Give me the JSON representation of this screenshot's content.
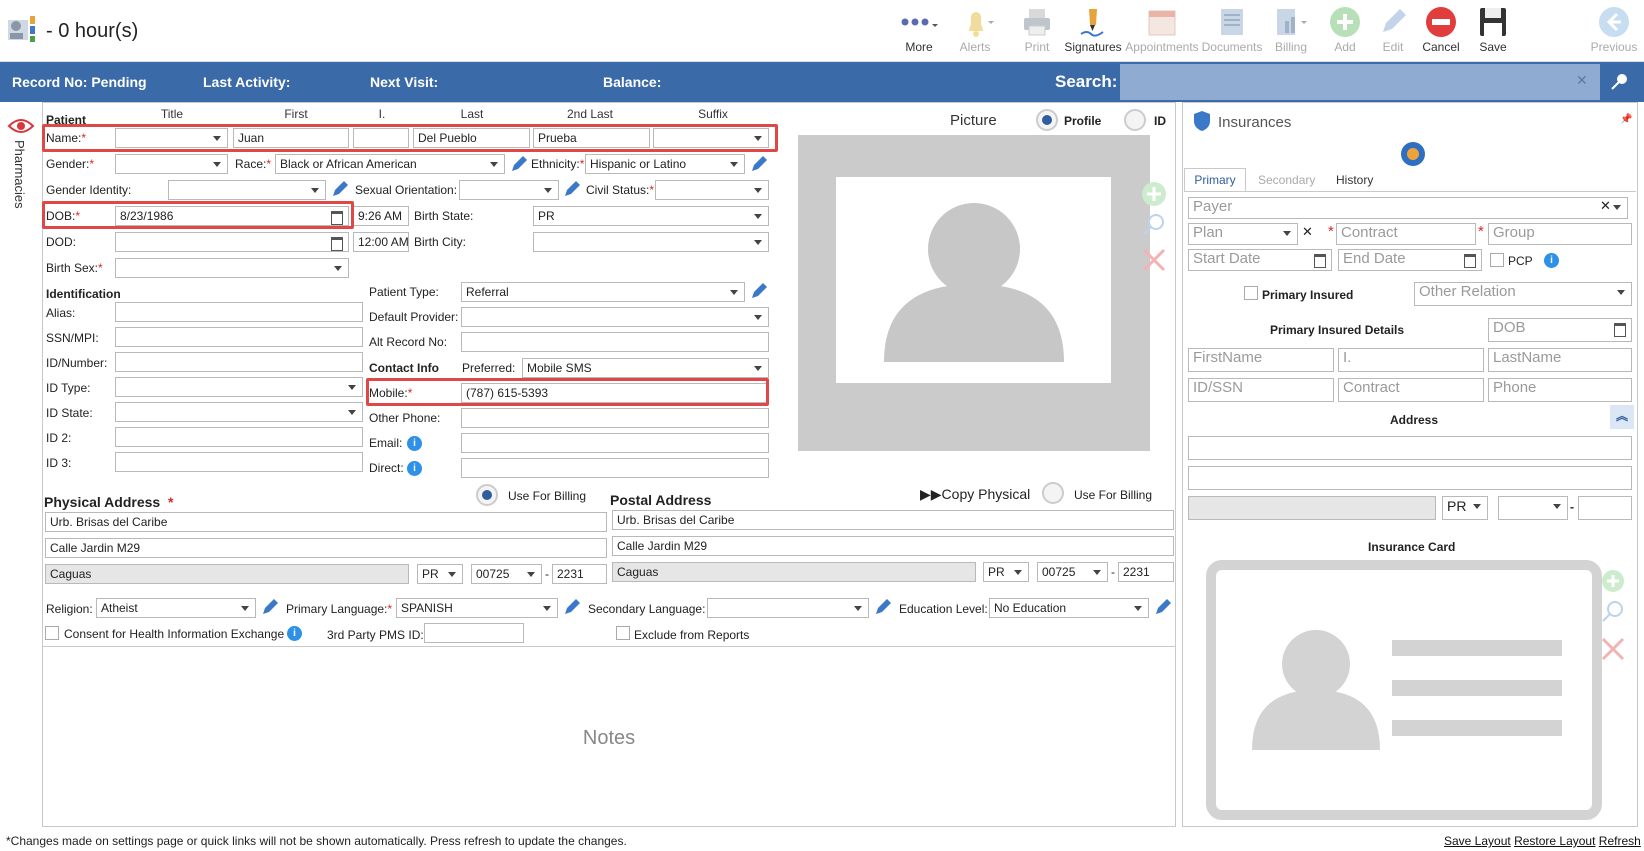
{
  "window": {
    "title": "- 0 hour(s)"
  },
  "toolbar": {
    "more": "More",
    "alerts": "Alerts",
    "print": "Print",
    "signatures": "Signatures",
    "appointments": "Appointments",
    "documents": "Documents",
    "billing": "Billing",
    "add": "Add",
    "edit": "Edit",
    "cancel": "Cancel",
    "save": "Save",
    "previous": "Previous"
  },
  "infobar": {
    "record_no": "Record No: Pending",
    "last_activity": "Last Activity:",
    "next_visit": "Next Visit:",
    "balance": "Balance:",
    "search_label": "Search:"
  },
  "side_tab": "Pharmacies",
  "patient": {
    "section": "Patient",
    "headers": {
      "title": "Title",
      "first": "First",
      "initial": "I.",
      "last": "Last",
      "second_last": "2nd Last",
      "suffix": "Suffix"
    },
    "name_label": "Name:",
    "first": "Juan",
    "last": "Del Pueblo",
    "second_last": "Prueba",
    "gender_label": "Gender:",
    "race_label": "Race:",
    "race": "Black or African American",
    "ethnicity_label": "Ethnicity:",
    "ethnicity": "Hispanic or Latino",
    "gender_identity_label": "Gender Identity:",
    "sexual_orientation_label": "Sexual Orientation:",
    "civil_status_label": "Civil Status:",
    "dob_label": "DOB:",
    "dob": "8/23/1986",
    "dob_time": "9:26 AM",
    "birth_state_label": "Birth State:",
    "birth_state": "PR",
    "dod_label": "DOD:",
    "dod_time": "12:00 AM",
    "birth_city_label": "Birth City:",
    "birth_sex_label": "Birth Sex:"
  },
  "identification": {
    "section": "Identification",
    "alias": "Alias:",
    "ssn": "SSN/MPI:",
    "id_number": "ID/Number:",
    "id_type": "ID Type:",
    "id_state": "ID State:",
    "id2": "ID 2:",
    "id3": "ID 3:"
  },
  "patient_info": {
    "patient_type_label": "Patient Type:",
    "patient_type": "Referral",
    "default_provider_label": "Default Provider:",
    "alt_record_label": "Alt Record No:"
  },
  "contact": {
    "section": "Contact Info",
    "preferred_label": "Preferred:",
    "preferred": "Mobile SMS",
    "mobile_label": "Mobile:",
    "mobile": "(787) 615-5393",
    "other_phone_label": "Other Phone:",
    "email_label": "Email:",
    "direct_label": "Direct:"
  },
  "picture": {
    "label": "Picture",
    "profile": "Profile",
    "id": "ID"
  },
  "physical_address": {
    "title": "Physical Address",
    "use_billing": "Use For Billing",
    "line1": "Urb. Brisas del Caribe",
    "line2": "Calle Jardin M29",
    "city": "Caguas",
    "state": "PR",
    "zip": "00725",
    "zip4": "2231"
  },
  "postal_address": {
    "title": "Postal Address",
    "copy": "Copy Physical",
    "use_billing": "Use For Billing",
    "line1": "Urb. Brisas del Caribe",
    "line2": "Calle Jardin M29",
    "city": "Caguas",
    "state": "PR",
    "zip": "00725",
    "zip4": "2231"
  },
  "misc": {
    "religion_label": "Religion:",
    "religion": "Atheist",
    "primary_language_label": "Primary Language:",
    "primary_language": "SPANISH",
    "secondary_language_label": "Secondary Language:",
    "education_label": "Education Level:",
    "education": "No Education",
    "consent": "Consent for Health Information Exchange",
    "third_party": "3rd Party PMS ID:",
    "exclude": "Exclude from Reports",
    "notes": "Notes"
  },
  "insurance": {
    "title": "Insurances",
    "tabs": [
      "Primary",
      "Secondary",
      "History"
    ],
    "payer": "Payer",
    "plan": "Plan",
    "contract": "Contract",
    "group": "Group",
    "start_date": "Start Date",
    "end_date": "End Date",
    "pcp": "PCP",
    "primary_insured": "Primary Insured",
    "other_relation": "Other Relation",
    "details_title": "Primary Insured Details",
    "dob": "DOB",
    "firstname": "FirstName",
    "initial": "I.",
    "lastname": "LastName",
    "id_ssn": "ID/SSN",
    "contract2": "Contract",
    "phone": "Phone",
    "address": "Address",
    "state": "PR",
    "card_title": "Insurance Card"
  },
  "footer": {
    "note": "*Changes made on settings page or quick links will not be shown automatically. Press refresh to update the changes.",
    "save_layout": "Save Layout",
    "restore_layout": "Restore Layout",
    "refresh": "Refresh"
  },
  "colors": {
    "accent": "#3b6aa8",
    "highlight": "#e04848",
    "required": "#d62828"
  }
}
